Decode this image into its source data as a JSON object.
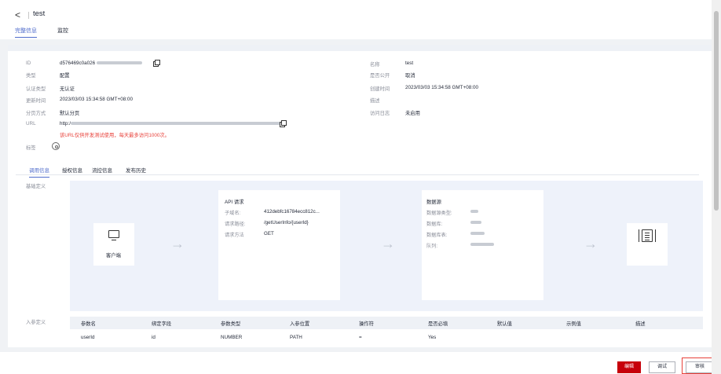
{
  "header": {
    "back_glyph": "<",
    "title": "test"
  },
  "tabs": [
    {
      "label": "完整信息",
      "active": true
    },
    {
      "label": "监控",
      "active": false
    }
  ],
  "details_left": [
    {
      "label": "ID",
      "value": "d576469c0a026"
    },
    {
      "label": "类型",
      "value": "配置"
    },
    {
      "label": "认证类型",
      "value": "无认证"
    },
    {
      "label": "更新时间",
      "value": "2023/03/03 15:34:58 GMT+08:00"
    },
    {
      "label": "分页方式",
      "value": "默认分页"
    },
    {
      "label": "URL",
      "value": "http:/"
    }
  ],
  "url_warning": "该URL仅供开发测试使用，每天最多访问1000次。",
  "tag_label": "标签",
  "details_right": [
    {
      "label": "名称",
      "value": "test"
    },
    {
      "label": "是否公开",
      "value": "取消"
    },
    {
      "label": "创建时间",
      "value": "2023/03/03 15:34:58 GMT+08:00"
    },
    {
      "label": "描述",
      "value": ""
    },
    {
      "label": "访问日志",
      "value": "未启用"
    }
  ],
  "subtabs": [
    {
      "label": "调用信息",
      "active": true
    },
    {
      "label": "授权信息",
      "active": false
    },
    {
      "label": "流控信息",
      "active": false
    },
    {
      "label": "发布历史",
      "active": false
    }
  ],
  "basic_def_label": "基础定义",
  "flow": {
    "client_label": "客户端",
    "arrow_glyph": "→",
    "api_request": {
      "title": "API 请求",
      "rows": [
        {
          "key": "子域名:",
          "value": "412debfc16784ecc812c..."
        },
        {
          "key": "请求路径:",
          "value": "/getUserInfo/{userId}"
        },
        {
          "key": "请求方法",
          "value": "GET"
        }
      ]
    },
    "datasource": {
      "title": "数据源",
      "rows": [
        {
          "key": "数据源类型:",
          "value": ""
        },
        {
          "key": "数据库:",
          "value": ""
        },
        {
          "key": "数据库表:",
          "value": ""
        },
        {
          "key": "队列:",
          "value": ""
        }
      ]
    }
  },
  "param_def_label": "入参定义",
  "params": {
    "headers": [
      "参数名",
      "绑定字段",
      "参数类型",
      "入参位置",
      "操作符",
      "是否必填",
      "默认值",
      "示例值",
      "描述"
    ],
    "rows": [
      [
        "userId",
        "id",
        "NUMBER",
        "PATH",
        "=",
        "Yes",
        "",
        "",
        ""
      ]
    ]
  },
  "footer": {
    "edit": "编辑",
    "debug": "调试",
    "review": "审核"
  },
  "colors": {
    "accent": "#526ecc",
    "danger": "#c7000b",
    "warning_text": "#e8413a"
  },
  "icons": [
    "back-icon",
    "copy-icon",
    "settings-icon",
    "monitor-icon",
    "arrow-right-icon",
    "list-icon"
  ]
}
